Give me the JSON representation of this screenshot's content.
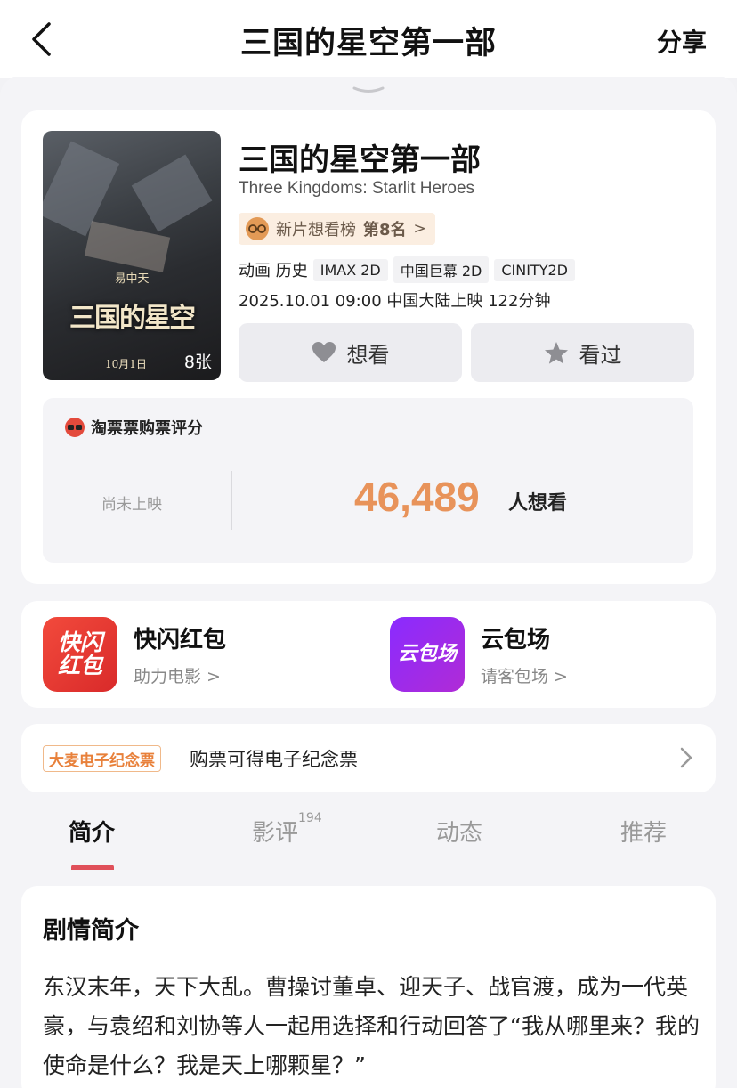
{
  "header": {
    "title": "三国的星空第一部",
    "share_label": "分享"
  },
  "movie": {
    "title": "三国的星空第一部",
    "english_title": "Three Kingdoms: Starlit Heroes",
    "rank": {
      "label": "新片想看榜",
      "position": "第8名",
      "chevron": ">"
    },
    "genres": "动画 历史",
    "formats": [
      "IMAX 2D",
      "中国巨幕 2D",
      "CINITY2D"
    ],
    "release_info": "2025.10.01 09:00 中国大陆上映 122分钟",
    "poster": {
      "author": "易中天",
      "name": "三国的星空",
      "date": "10月1日",
      "image_count": "8张"
    },
    "want_button_label": "想看",
    "watched_button_label": "看过"
  },
  "rating": {
    "heading": "淘票票购票评分",
    "status": "尚未上映",
    "want_count": "46,489",
    "want_suffix": "人想看"
  },
  "promos": [
    {
      "icon_text": "快闪红包",
      "title": "快闪红包",
      "subtitle": "助力电影 >"
    },
    {
      "icon_text": "云包场",
      "title": "云包场",
      "subtitle": "请客包场 >"
    }
  ],
  "ticket": {
    "badge": "大麦电子纪念票",
    "text": "购票可得电子纪念票"
  },
  "tabs": [
    {
      "label": "简介",
      "active": true
    },
    {
      "label": "影评",
      "count": "194"
    },
    {
      "label": "动态"
    },
    {
      "label": "推荐"
    }
  ],
  "synopsis": {
    "heading": "剧情简介",
    "body": "东汉末年，天下大乱。曹操讨董卓、迎天子、战官渡，成为一代英豪，与袁绍和刘协等人一起用选择和行动回答了“我从哪里来？我的使命是什么？我是天上哪颗星？”"
  },
  "colors": {
    "accent_orange": "#e8935a",
    "tab_indicator": "#e0505a",
    "promo_red": "#e0302c",
    "promo_purple": "#9a2bf0"
  }
}
